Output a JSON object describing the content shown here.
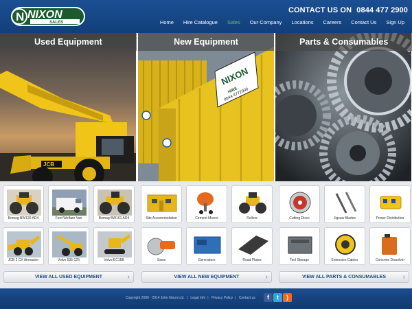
{
  "header": {
    "logo_text": "NIXON",
    "logo_sub": "SALES",
    "contact_label": "CONTACT US ON",
    "contact_phone": "0844 477 2900",
    "nav": [
      {
        "label": "Home"
      },
      {
        "label": "Hire Catalogue"
      },
      {
        "label": "Sales",
        "active": true
      },
      {
        "label": "Our Company"
      },
      {
        "label": "Locations"
      },
      {
        "label": "Careers"
      },
      {
        "label": "Contact Us"
      },
      {
        "label": "Sign Up"
      }
    ]
  },
  "panels": [
    {
      "title": "Used Equipment"
    },
    {
      "title": "New Equipment",
      "sign_text": "NIXON",
      "sign_sub": "HIRE",
      "sign_phone": "0844 4772900"
    },
    {
      "title": "Parts & Consumables"
    }
  ],
  "used": {
    "items": [
      {
        "label": "Bomag BW120 AD4"
      },
      {
        "label": "Ford Welfare Van"
      },
      {
        "label": "Bomag BW161 AD4"
      },
      {
        "label": "JCB 2 CX Airmaster"
      },
      {
        "label": "Volvo 535-125"
      },
      {
        "label": "Volvo EC15B"
      }
    ],
    "view_all": "VIEW ALL USED EQUIPMENT"
  },
  "new": {
    "items": [
      {
        "label": "Site Accommodation"
      },
      {
        "label": "Cement Mixers"
      },
      {
        "label": "Rollers"
      },
      {
        "label": "Saws"
      },
      {
        "label": "Generators"
      },
      {
        "label": "Road Plates"
      }
    ],
    "view_all": "VIEW ALL NEW EQUIPMENT"
  },
  "parts": {
    "items": [
      {
        "label": "Cutting Discs"
      },
      {
        "label": "Jigsaw Blades"
      },
      {
        "label": "Power Distribution"
      },
      {
        "label": "Tool Storage"
      },
      {
        "label": "Extension Cables"
      },
      {
        "label": "Concrete Dissolver"
      }
    ],
    "view_all": "VIEW ALL PARTS & CONSUMABLES"
  },
  "footer": {
    "copyright": "Copyright 2006 - 2014 John Nixon Ltd.",
    "links": [
      "Legal Info",
      "Privacy Policy",
      "Contact us"
    ],
    "social": [
      {
        "icon": "facebook-icon",
        "glyph": "f",
        "color": "#3b5998"
      },
      {
        "icon": "twitter-icon",
        "glyph": "t",
        "color": "#29a9e1"
      },
      {
        "icon": "rss-icon",
        "glyph": ")",
        "color": "#f26522"
      }
    ]
  },
  "colors": {
    "brand_blue": "#1b4f92",
    "accent_green": "#66c26a",
    "jcb_yellow": "#f0c419"
  }
}
